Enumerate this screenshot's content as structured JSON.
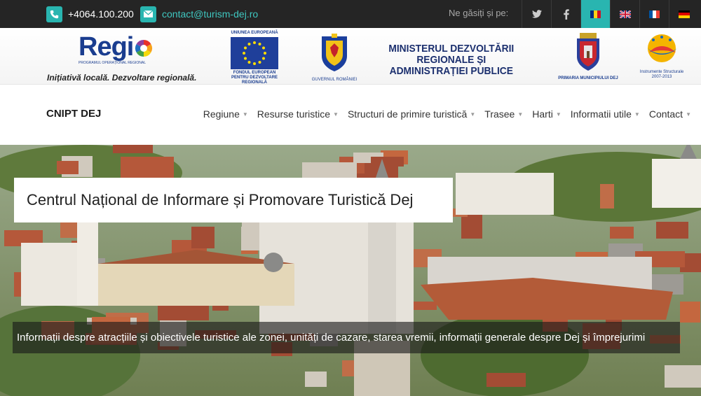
{
  "topbar": {
    "phone": "+4064.100.200",
    "email": "contact@turism-dej.ro",
    "find_us": "Ne găsiți și pe:",
    "social": [
      {
        "icon": "twitter-icon"
      },
      {
        "icon": "facebook-icon"
      }
    ],
    "languages": [
      {
        "icon": "flag-romania-icon",
        "active": true
      },
      {
        "icon": "flag-uk-icon"
      },
      {
        "icon": "flag-france-icon"
      },
      {
        "icon": "flag-germany-icon"
      }
    ]
  },
  "partners": {
    "regio_word": "Regi",
    "regio_sub": "PROGRAMUL OPERAȚIONAL REGIONAL",
    "regio_tagline": "Inițiativă locală. Dezvoltare regională.",
    "eu_top": "UNIUNEA EUROPEANĂ",
    "eu_bottom": "FONDUL EUROPEAN PENTRU DEZVOLTARE REGIONALĂ",
    "government": "GUVERNUL ROMÂNIEI",
    "ministry": "MINISTERUL DEZVOLTĂRII REGIONALE ȘI ADMINISTRAȚIEI PUBLICE",
    "primaria": "PRIMARIA MUNICIPIULUI DEJ",
    "instruments": "Instrumente Structurale 2007-2013"
  },
  "nav": {
    "brand": "CNIPT DEJ",
    "items": [
      {
        "label": "Regiune"
      },
      {
        "label": "Resurse turistice"
      },
      {
        "label": "Structuri de primire turistică"
      },
      {
        "label": "Trasee"
      },
      {
        "label": "Harti"
      },
      {
        "label": "Informatii utile"
      },
      {
        "label": "Contact"
      }
    ]
  },
  "hero": {
    "title": "Centrul Național de Informare și Promovare Turistică Dej",
    "description": "Informații despre atracțiile și obiectivele turistice ale zonei, unități de cazare, starea vremii, informații generale despre Dej și împrejurimi"
  },
  "colors": {
    "accent": "#29b5b0",
    "topbar": "#252525",
    "regio_blue": "#1a3d8f"
  }
}
